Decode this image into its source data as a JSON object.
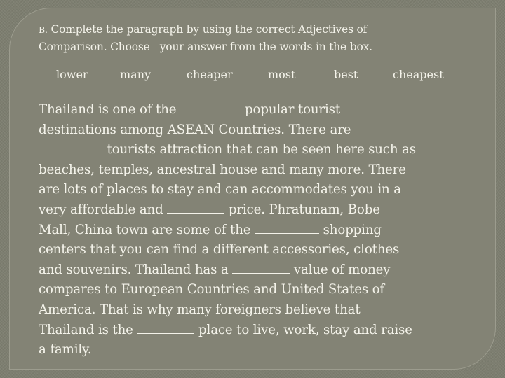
{
  "instructions": {
    "label": "B.",
    "line1": "Complete the paragraph by using the correct Adjectives of",
    "line2": "Comparison. Choose   your answer from the words in the box."
  },
  "word_box": [
    "lower",
    "many",
    "cheaper",
    "most",
    "best",
    "cheapest"
  ],
  "paragraph": {
    "lines": [
      {
        "before": "Thailand is one of the ",
        "blank": "________",
        "after": "popular tourist"
      },
      {
        "before": "destinations among ASEAN Countries. There are",
        "blank": null,
        "after": ""
      },
      {
        "before": "",
        "blank": "________",
        "after": " tourists attraction that can be seen here such as"
      },
      {
        "before": "beaches, temples, ancestral house and many more. There",
        "blank": null,
        "after": ""
      },
      {
        "before": "are lots of places to stay and can accommodates you in a",
        "blank": null,
        "after": ""
      },
      {
        "before": "very affordable and ",
        "blank": "_______",
        "after": " price. Phratunam, Bobe"
      },
      {
        "before": "Mall, China town are some of the ",
        "blank": "________",
        "after": " shopping"
      },
      {
        "before": "centers that you can find a different accessories, clothes",
        "blank": null,
        "after": ""
      },
      {
        "before": "and souvenirs. Thailand has a ",
        "blank": "_______",
        "after": " value of money"
      },
      {
        "before": "compares to European Countries and United States of",
        "blank": null,
        "after": ""
      },
      {
        "before": "America. That is why many foreigners believe that",
        "blank": null,
        "after": ""
      },
      {
        "before": "Thailand is the ",
        "blank": "_______",
        "after": " place to live, work, stay and raise"
      },
      {
        "before": "a family.",
        "blank": null,
        "after": ""
      }
    ]
  }
}
